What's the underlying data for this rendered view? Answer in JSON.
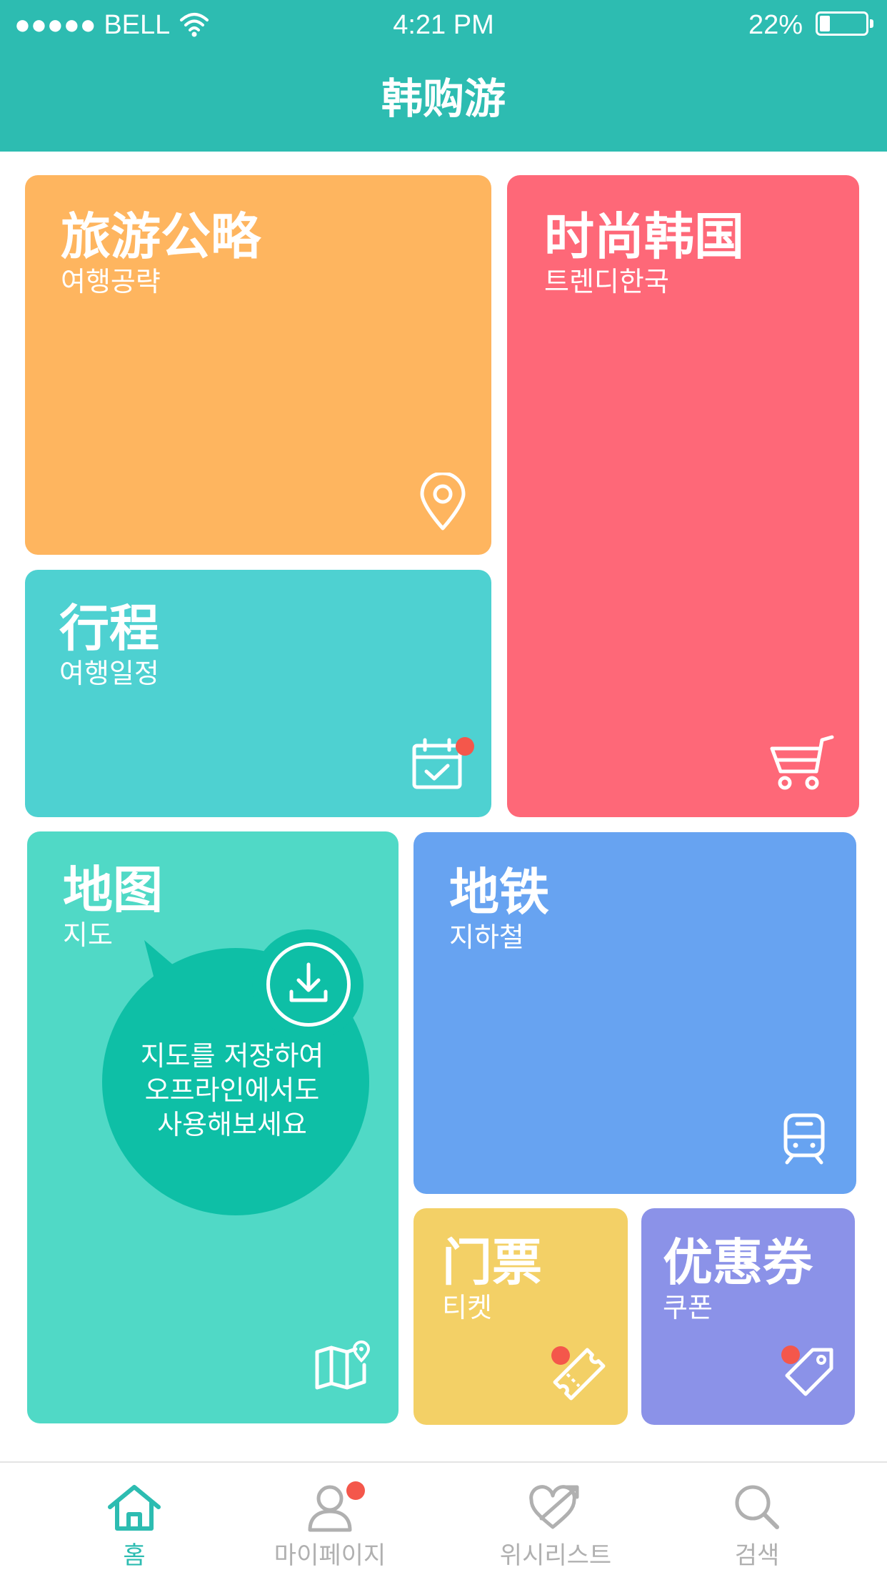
{
  "status_bar": {
    "carrier": "●●●●● BELL",
    "time": "4:21 PM",
    "battery": "22%",
    "battery_level": 0.22
  },
  "header": {
    "title": "韩购游"
  },
  "tiles": {
    "travel_guide": {
      "title": "旅游公略",
      "subtitle": "여행공략",
      "color": "#feb55f",
      "icon": "location-pin-icon"
    },
    "trendy_korea": {
      "title": "时尚韩国",
      "subtitle": "트렌디한국",
      "color": "#fe6878",
      "icon": "shopping-cart-icon"
    },
    "itinerary": {
      "title": "行程",
      "subtitle": "여행일정",
      "color": "#4ed1d1",
      "icon": "calendar-check-icon"
    },
    "map": {
      "title": "地图",
      "subtitle": "지도",
      "color": "#50d9c6",
      "icon": "map-icon",
      "bubble_lines": [
        "지도를 저장하여",
        "오프라인에서도",
        "사용해보세요"
      ],
      "bubble_color": "#0ebfa6"
    },
    "subway": {
      "title": "地铁",
      "subtitle": "지하철",
      "color": "#67a3f1",
      "icon": "train-icon"
    },
    "tickets": {
      "title": "门票",
      "subtitle": "티켓",
      "color": "#f3d066",
      "icon": "ticket-icon"
    },
    "coupons": {
      "title": "优惠券",
      "subtitle": "쿠폰",
      "color": "#8b92e8",
      "icon": "tag-icon"
    }
  },
  "tabbar": {
    "home": {
      "label": "홈",
      "icon": "home-icon",
      "active": true
    },
    "mypage": {
      "label": "마이페이지",
      "icon": "user-icon"
    },
    "wishlist": {
      "label": "위시리스트",
      "icon": "heart-arrow-icon"
    },
    "search": {
      "label": "검색",
      "icon": "search-icon"
    }
  },
  "colors": {
    "accent": "#2dbcb1",
    "notification": "#f4574b",
    "inactive": "#b0b0b0"
  }
}
